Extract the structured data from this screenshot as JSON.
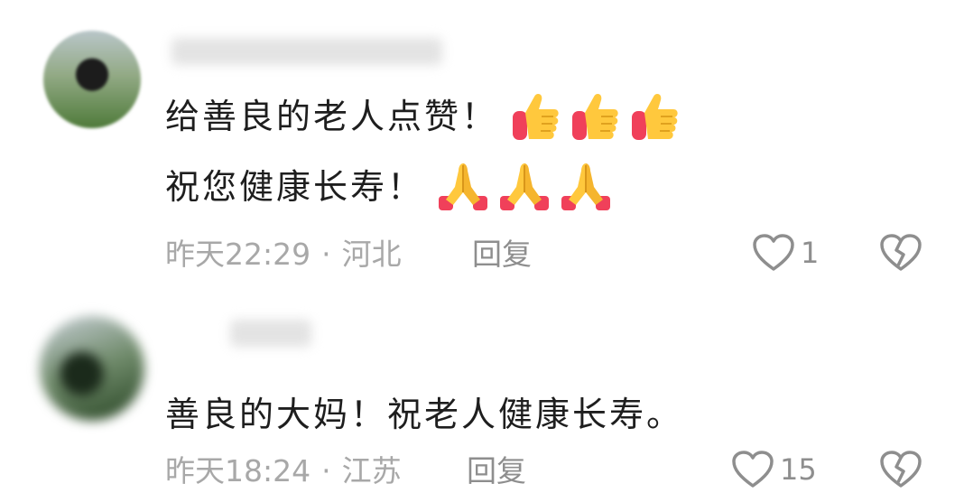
{
  "comments": [
    {
      "username": "",
      "lines": [
        "给善良的老人点赞！",
        "祝您健康长寿！"
      ],
      "emoji_line1": [
        "thumbs-up-icon",
        "thumbs-up-icon",
        "thumbs-up-icon"
      ],
      "emoji_line2": [
        "folded-hands-icon",
        "folded-hands-icon",
        "folded-hands-icon"
      ],
      "time": "昨天22:29",
      "separator": "·",
      "location": "河北",
      "reply_label": "回复",
      "like_count": "1"
    },
    {
      "username": "",
      "lines": [
        "善良的大妈！祝老人健康长寿。"
      ],
      "time": "昨天18:24",
      "separator": "·",
      "location": "江苏",
      "reply_label": "回复",
      "like_count": "15"
    }
  ],
  "colors": {
    "text": "#1e1e1e",
    "meta": "#a8a8a8",
    "icon": "#8e8e8e",
    "emoji_yellow": "#ffc83d",
    "emoji_red": "#f0405a"
  }
}
